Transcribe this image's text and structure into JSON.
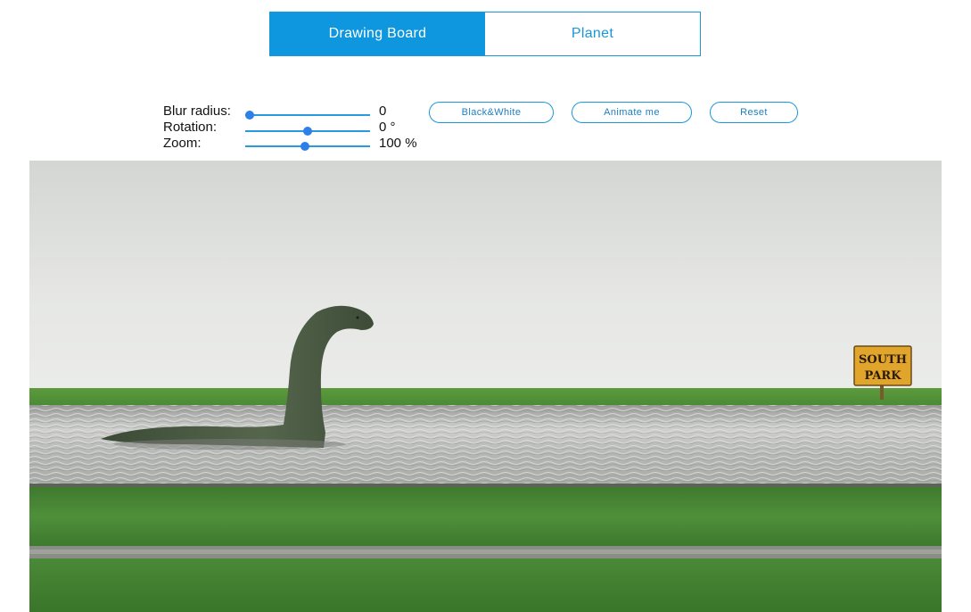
{
  "tabs": [
    {
      "label": "Drawing Board",
      "active": true
    },
    {
      "label": "Planet",
      "active": false
    }
  ],
  "controls": {
    "blur": {
      "label": "Blur radius:",
      "value": "0",
      "level": 0.0
    },
    "rotation": {
      "label": "Rotation:",
      "value": "0 °",
      "level": 0.5
    },
    "zoom": {
      "label": "Zoom:",
      "value": "100 %",
      "level": 0.48
    }
  },
  "buttons": {
    "bw": "Black&White",
    "animate": "Animate me",
    "reset": "Reset"
  },
  "image": {
    "sign_line1": "SOUTH",
    "sign_line2": "PARK"
  },
  "colors": {
    "accent": "#0e97de",
    "slider_thumb": "#2f7fe8"
  }
}
